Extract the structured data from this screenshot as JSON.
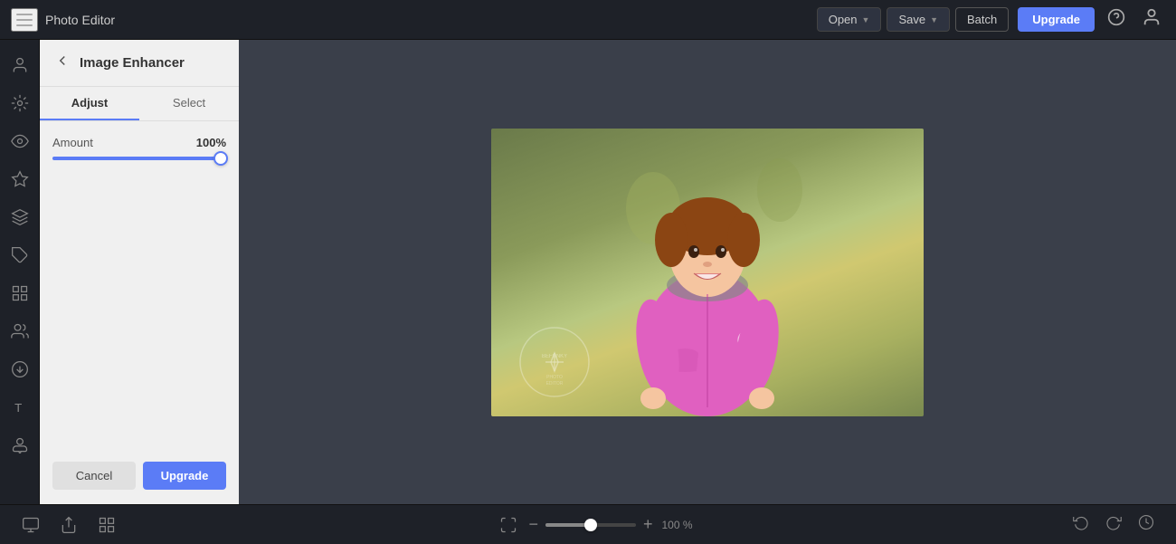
{
  "app": {
    "title": "Photo Editor"
  },
  "topbar": {
    "open_label": "Open",
    "save_label": "Save",
    "batch_label": "Batch",
    "upgrade_label": "Upgrade"
  },
  "panel": {
    "title": "Image Enhancer",
    "tab_adjust": "Adjust",
    "tab_select": "Select",
    "amount_label": "Amount",
    "amount_value": "100%",
    "cancel_label": "Cancel",
    "upgrade_label": "Upgrade"
  },
  "bottombar": {
    "zoom_percent": "100 %"
  }
}
